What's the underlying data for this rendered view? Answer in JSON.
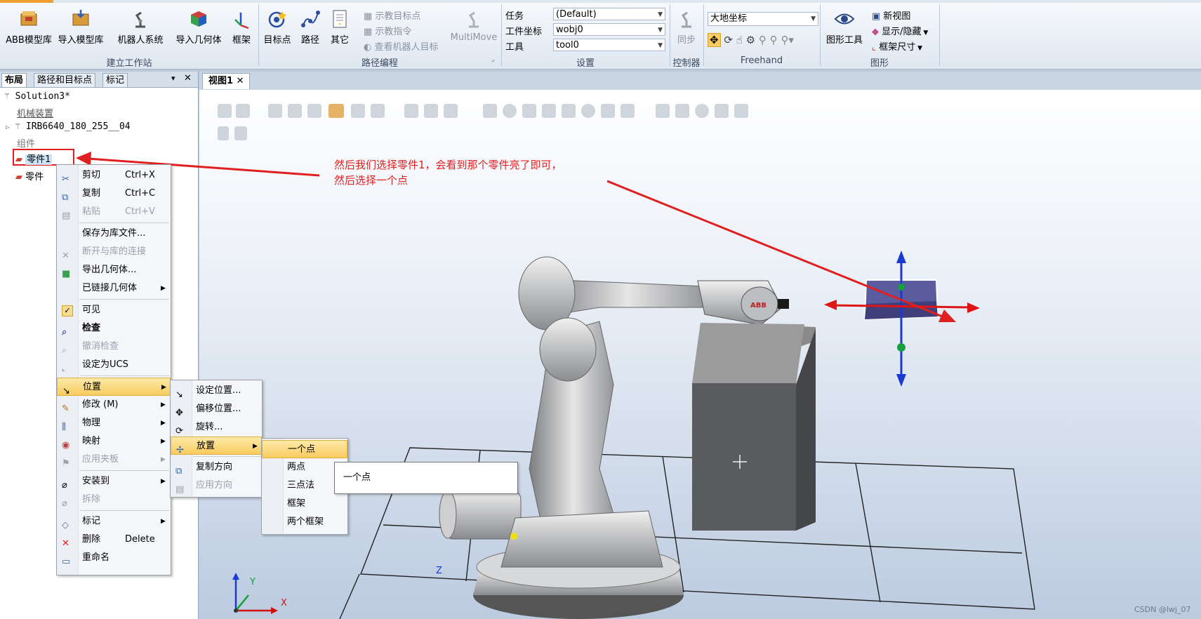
{
  "ribbon": {
    "groups": {
      "build": "建立工作站",
      "path": "路径编程",
      "settings": "设置",
      "controller": "控制器",
      "freehand": "Freehand",
      "graphics": "图形"
    },
    "buttons": {
      "abb_library": "ABB模型库",
      "import_library": "导入模型库",
      "robot_system": "机器人系统",
      "import_geometry": "导入几何体",
      "frame": "框架",
      "target": "目标点",
      "path": "路径",
      "other": "其它",
      "teach_target": "示教目标点",
      "teach_instruction": "示教指令",
      "view_robot_target": "查看机器人目标",
      "multimove": "MultiMove",
      "sync": "同步",
      "graphics_tools": "图形工具",
      "new_view": "新视图",
      "show_hide": "显示/隐藏",
      "frame_size": "框架尺寸"
    },
    "settings": {
      "task_label": "任务",
      "task_value": "(Default)",
      "wobj_label": "工件坐标",
      "wobj_value": "wobj0",
      "tool_label": "工具",
      "tool_value": "tool0"
    },
    "freehand_ref": "大地坐标"
  },
  "left_panel": {
    "tabs": [
      "布局",
      "路径和目标点",
      "标记"
    ],
    "tree": {
      "solution": "Solution3*",
      "mechanisms": "机械装置",
      "robot": "IRB6640_180_255__04",
      "components": "组件",
      "part1": "零件1",
      "part2": "零件"
    }
  },
  "view": {
    "tab": "视图1",
    "annotation_line1": "然后我们选择零件1，会看到那个零件亮了即可，",
    "annotation_line2": "然后选择一个点",
    "axis_x": "X",
    "axis_y": "Y",
    "axis_z": "Z",
    "watermark": "CSDN @lwj_07",
    "annotation_color": "#e02020"
  },
  "context_menu": {
    "items": [
      {
        "label": "剪切",
        "shortcut": "Ctrl+X"
      },
      {
        "label": "复制",
        "shortcut": "Ctrl+C"
      },
      {
        "label": "粘贴",
        "shortcut": "Ctrl+V"
      },
      {
        "label": "保存为库文件..."
      },
      {
        "label": "断开与库的连接"
      },
      {
        "label": "导出几何体..."
      },
      {
        "label": "已链接几何体"
      },
      {
        "label": "可见"
      },
      {
        "label": "检查"
      },
      {
        "label": "撤消检查"
      },
      {
        "label": "设定为UCS"
      },
      {
        "label": "位置"
      },
      {
        "label": "修改 (M)"
      },
      {
        "label": "物理"
      },
      {
        "label": "映射"
      },
      {
        "label": "应用夹板"
      },
      {
        "label": "安装到"
      },
      {
        "label": "拆除"
      },
      {
        "label": "标记"
      },
      {
        "label": "删除",
        "shortcut": "Delete"
      },
      {
        "label": "重命名"
      }
    ]
  },
  "position_menu": {
    "items": [
      "设定位置...",
      "偏移位置...",
      "旋转...",
      "放置",
      "复制方向",
      "应用方向"
    ]
  },
  "place_menu": {
    "items": [
      "一个点",
      "两点",
      "三点法",
      "框架",
      "两个框架"
    ]
  },
  "tooltip": "一个点"
}
